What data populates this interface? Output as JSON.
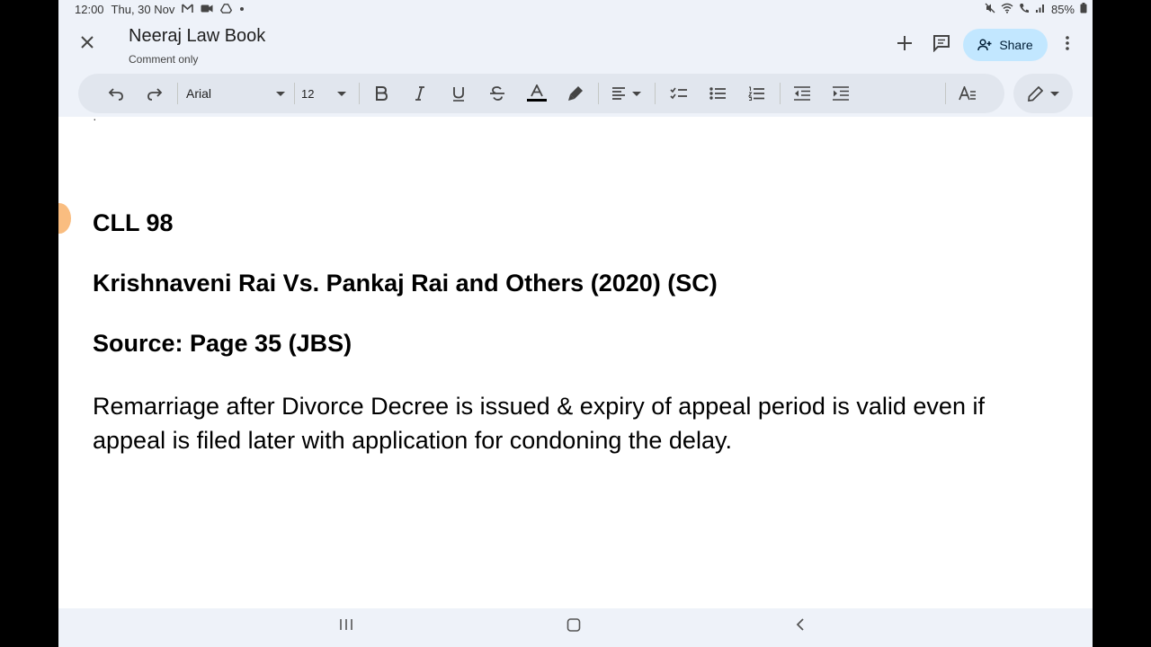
{
  "status_bar": {
    "time": "12:00",
    "date": "Thu, 30 Nov",
    "notification_icons": [
      "gmail-icon",
      "meet-icon",
      "drive-icon",
      "dot-icon"
    ],
    "right_icons": [
      "mute-icon",
      "wifi-icon",
      "call-icon",
      "signal-icon"
    ],
    "battery": "85%"
  },
  "header": {
    "title": "Neeraj Law Book",
    "mode": "Comment only",
    "share_label": "Share"
  },
  "toolbar": {
    "font": "Arial",
    "font_size": "12"
  },
  "document": {
    "line1": "CLL 98",
    "line2": "Krishnaveni Rai Vs. Pankaj Rai and Others (2020) (SC)",
    "line3": "Source: Page 35 (JBS)",
    "paragraph": "Remarriage after Divorce Decree is issued & expiry of appeal period is valid even if appeal is filed later with application for condoning the delay."
  },
  "colors": {
    "header_bg": "#eef2f9",
    "toolbar_bg": "#e1e6ee",
    "share_bg": "#c2e7ff"
  }
}
